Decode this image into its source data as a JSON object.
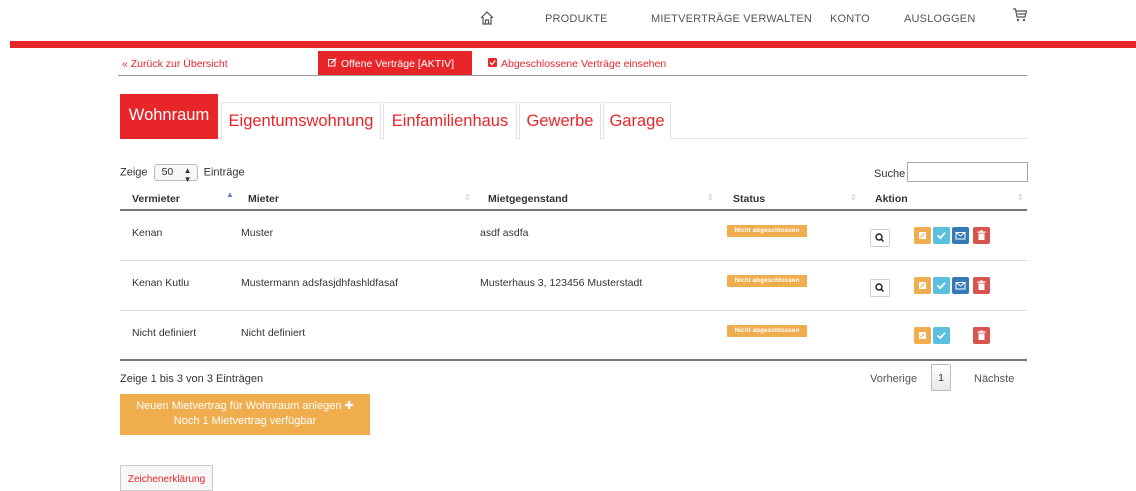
{
  "nav": {
    "home_icon": "home-icon",
    "items": [
      "PRODUKTE",
      "MIETVERTRÄGE VERWALTEN",
      "KONTO",
      "AUSLOGGEN"
    ],
    "cart_icon": "cart-icon",
    "accent": "#e8262a"
  },
  "subnav": {
    "back": "« Zurück zur Übersicht",
    "active": "Offene Verträge [AKTIV]",
    "closed": "Abgeschlossene Verträge einsehen"
  },
  "tabs": [
    {
      "label": "Wohnraum",
      "active": true
    },
    {
      "label": "Eigentumswohnung",
      "active": false
    },
    {
      "label": "Einfamilienhaus",
      "active": false
    },
    {
      "label": "Gewerbe",
      "active": false
    },
    {
      "label": "Garage",
      "active": false
    }
  ],
  "length": {
    "prefix": "Zeige",
    "value": "50",
    "suffix": "Einträge"
  },
  "search": {
    "label": "Suche",
    "value": ""
  },
  "table": {
    "columns": [
      "Vermieter",
      "Mieter",
      "Mietgegenstand",
      "Status",
      "Aktion"
    ],
    "rows": [
      {
        "vermieter": "Kenan",
        "mieter": "Muster",
        "mietgegenstand": "asdf asdfa",
        "status": "Nicht abgeschlossen"
      },
      {
        "vermieter": "Kenan Kutlu",
        "mieter": "Mustermann adsfasjdhfashldfasaf",
        "mietgegenstand": "Musterhaus 3, 123456 Musterstadt",
        "status": "Nicht abgeschlossen"
      },
      {
        "vermieter": "Nicht definiert",
        "mieter": "Nicht definiert",
        "mietgegenstand": "",
        "status": "Nicht abgeschlossen"
      }
    ]
  },
  "footer": {
    "info": "Zeige 1 bis 3 von 3 Einträgen",
    "prev": "Vorherige",
    "page": "1",
    "next": "Nächste"
  },
  "new_button": {
    "line1": "Neuen Mietvertrag für Wohnraum anlegen",
    "plus": "✚",
    "line2": "Noch 1 Mietvertrag verfügbar"
  },
  "legend_button": "Zeichenerklärung"
}
